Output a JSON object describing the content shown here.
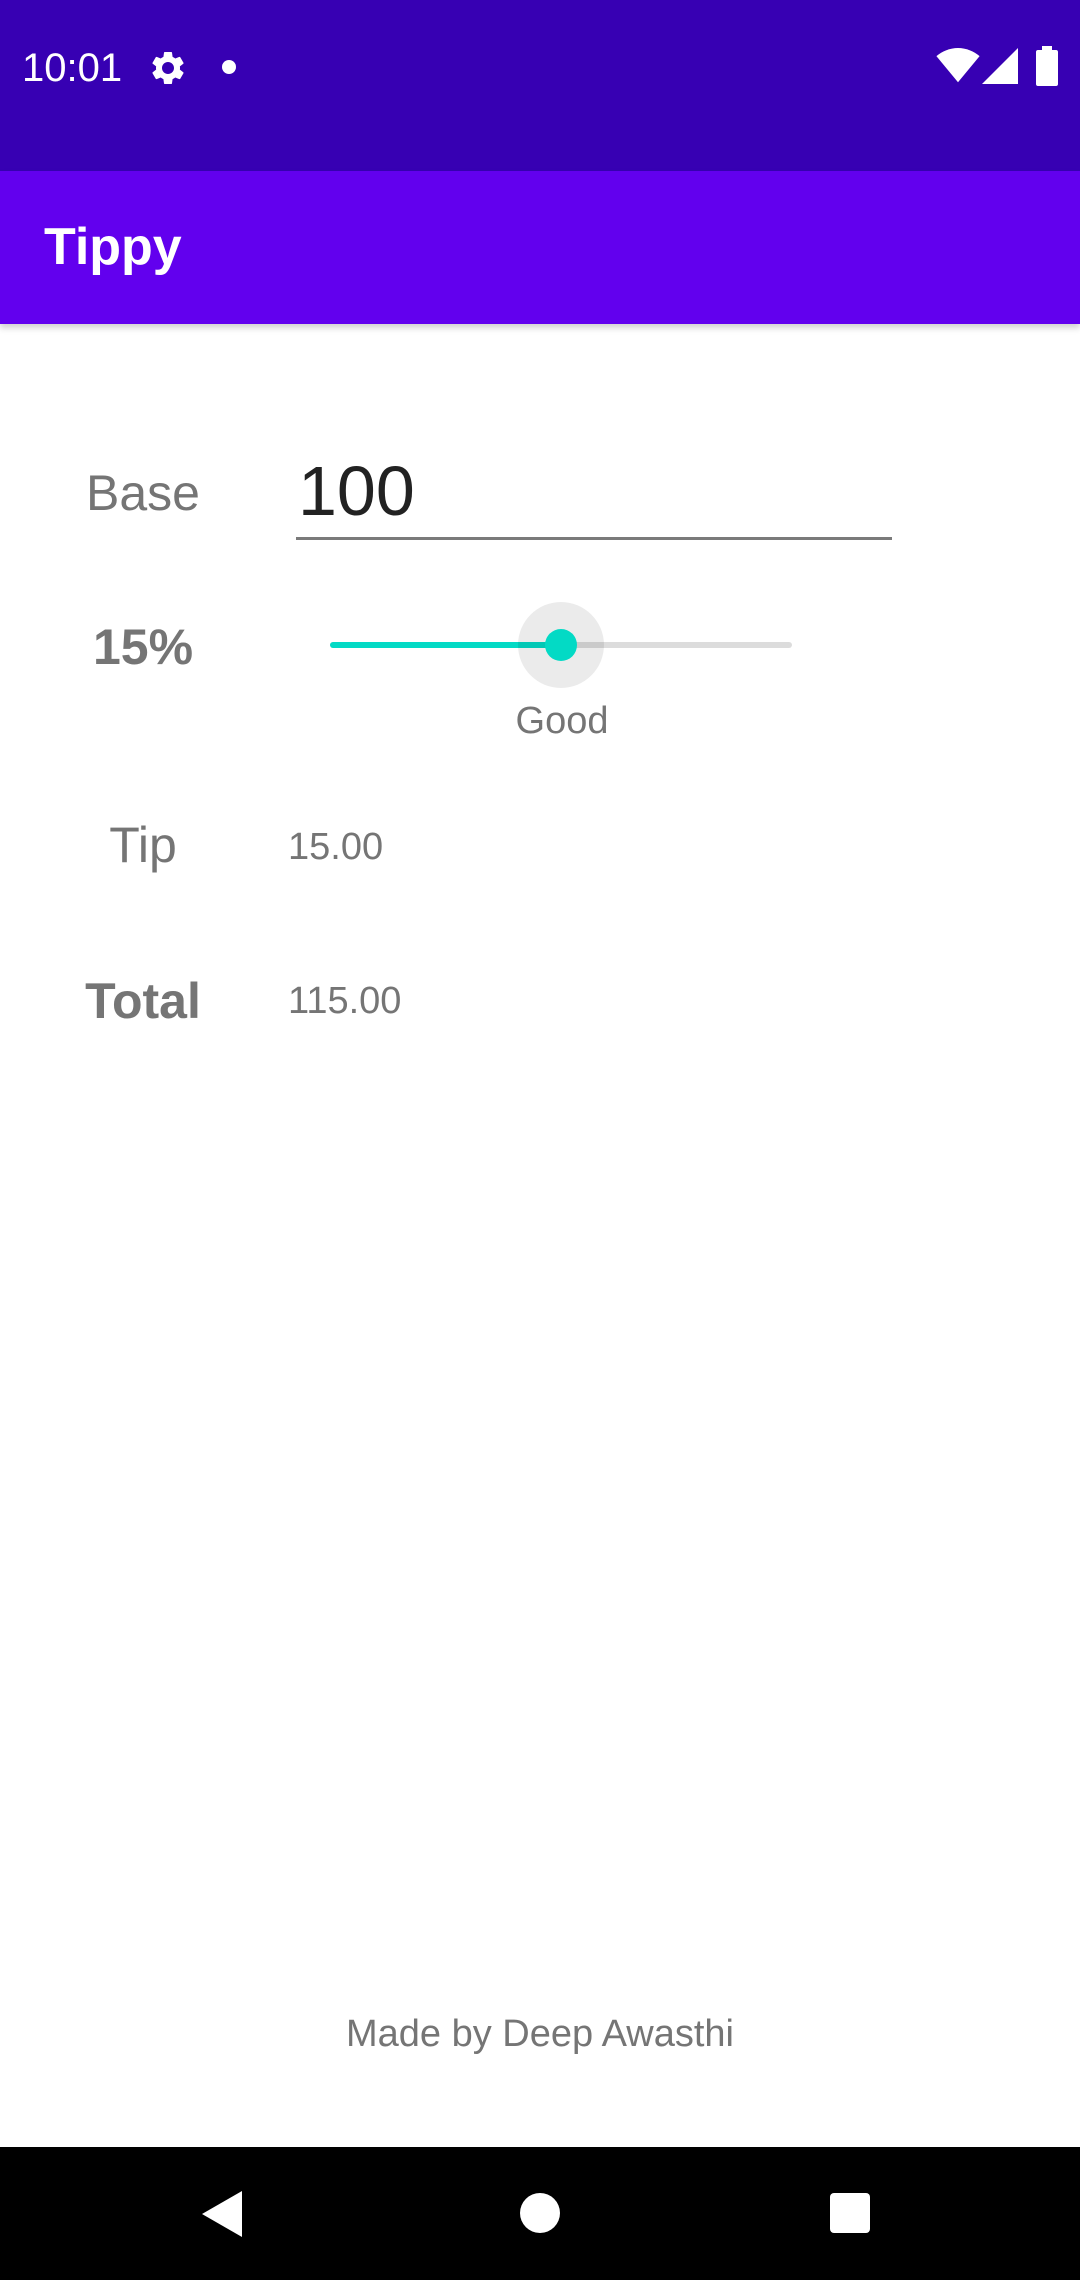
{
  "status_bar": {
    "time": "10:01",
    "icons": [
      "gear-icon",
      "notification-dot-icon",
      "wifi-icon",
      "cell-signal-icon",
      "battery-icon"
    ],
    "background_color": "#3700b3"
  },
  "app_bar": {
    "title": "Tippy",
    "background_color": "#6200ee"
  },
  "form": {
    "base_label": "Base",
    "base_value": "100",
    "tip_percent_label": "15%",
    "tip_percent": 15,
    "tip_percent_max": 30,
    "tip_description": "Good",
    "tip_label": "Tip",
    "tip_amount": "15.00",
    "total_label": "Total",
    "total_amount": "115.00",
    "slider_color": "#03dac5"
  },
  "footer": {
    "text": "Made by Deep Awasthi"
  },
  "nav_bar": {
    "icons": [
      "back-icon",
      "home-icon",
      "recents-icon"
    ]
  }
}
